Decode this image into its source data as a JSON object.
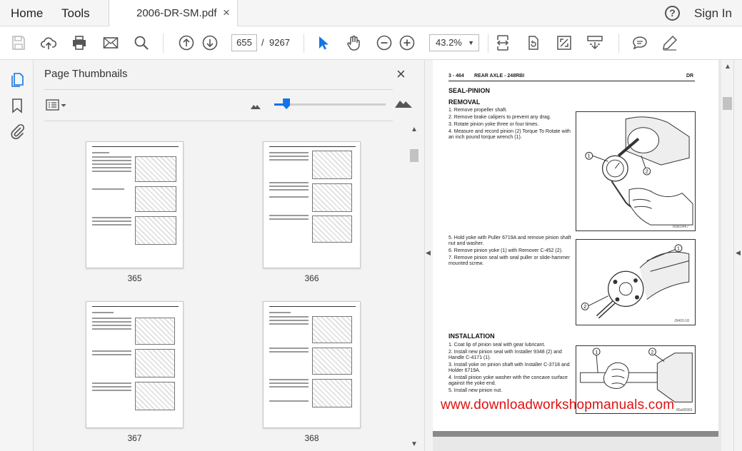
{
  "menu": {
    "home": "Home",
    "tools": "Tools",
    "sign_in": "Sign In",
    "help": "?"
  },
  "tab": {
    "title": "2006-DR-SM.pdf",
    "close": "×"
  },
  "toolbar": {
    "current_page": "655",
    "page_separator": "/",
    "total_pages": "9267",
    "zoom": "43.2%"
  },
  "icons": {
    "toolbar": [
      "save-icon",
      "upload-icon",
      "print-icon",
      "email-icon",
      "search-icon",
      "prev-page-icon",
      "next-page-icon",
      "select-cursor-icon",
      "hand-icon",
      "zoom-out-icon",
      "zoom-in-icon",
      "fit-width-icon",
      "rotate-icon",
      "full-screen-icon",
      "scroll-mode-icon",
      "comment-icon",
      "pen-icon"
    ],
    "rail": [
      "page-thumbnails-icon",
      "bookmark-icon",
      "attachment-icon"
    ]
  },
  "panel": {
    "title": "Page Thumbnails",
    "close": "×"
  },
  "thumbnails": [
    {
      "page": "365"
    },
    {
      "page": "366"
    },
    {
      "page": "367"
    },
    {
      "page": "368"
    }
  ],
  "document": {
    "header_left": "3 - 464",
    "header_center": "REAR AXLE - 248RBI",
    "header_right": "DR",
    "section_title": "SEAL-PINION",
    "removal_heading": "REMOVAL",
    "removal_steps_a": [
      "1.  Remove propeller shaft.",
      "2.  Remove brake calipers to prevent any drag.",
      "3.  Rotate pinion yoke three or four times.",
      "4.  Measure and record pinion (2) Torque To Rotate with an inch pound torque wrench (1)."
    ],
    "removal_steps_b": [
      "5.  Hold yoke with Puller 6719A and remove pinion shaft nut and washer.",
      "6.  Remove pinion yoke (1) with Remover C-452 (2).",
      "7.  Remove pinion seal with seal puller or slide-hammer mounted screw."
    ],
    "installation_heading": "INSTALLATION",
    "installation_steps": [
      "1.  Coat lip of pinion seal with gear lubricant.",
      "2.  Install new pinion seal with Installer 9348 (2) and Handle C-4171 (1).",
      "3.  Install yoke on pinion shaft with Installer C-3718 and Holder 6719A.",
      "4.  Install pinion yoke washer with the concave surface against the yoke end.",
      "5.  Install new pinion nut."
    ],
    "figure_codes": [
      "80a03467",
      "J9403-18",
      "80a08369"
    ],
    "callouts": [
      "1",
      "2"
    ],
    "watermark": "www.downloadworkshopmanuals.com"
  },
  "colors": {
    "accent": "#1473e6",
    "watermark": "#e01010"
  }
}
